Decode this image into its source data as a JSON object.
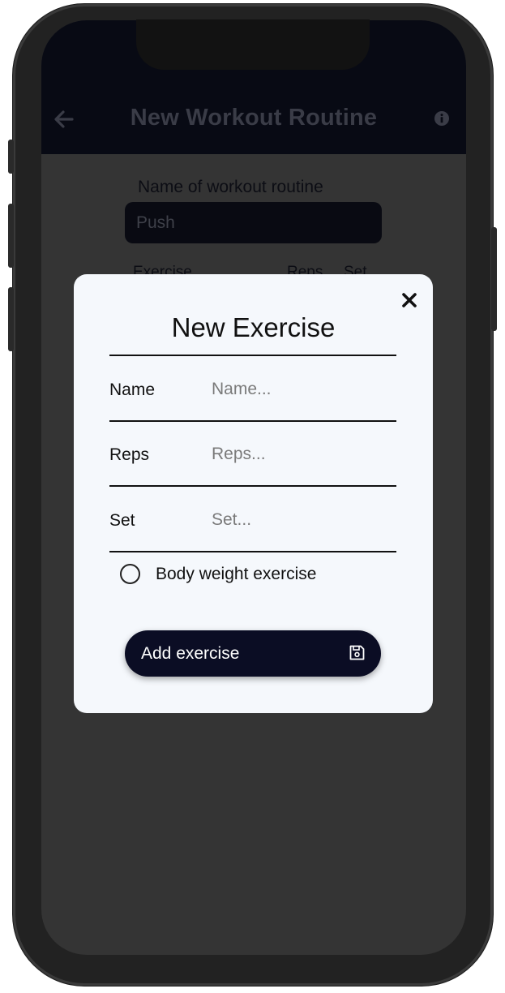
{
  "header": {
    "title": "New Workout Routine",
    "back_icon": "arrow-left-icon",
    "info_icon": "info-circle-icon"
  },
  "form": {
    "name_label": "Name of workout routine",
    "name_value": "Push",
    "columns": [
      "Exercise",
      "Reps",
      "Set"
    ]
  },
  "modal": {
    "title": "New Exercise",
    "close_icon": "close-icon",
    "fields": [
      {
        "label": "Name",
        "placeholder": "Name..."
      },
      {
        "label": "Reps",
        "placeholder": "Reps..."
      },
      {
        "label": "Set",
        "placeholder": "Set..."
      }
    ],
    "body_weight_label": "Body weight exercise",
    "body_weight_checked": false,
    "add_button_label": "Add exercise",
    "save_icon": "save-icon"
  },
  "colors": {
    "overlay_background": "#343434",
    "header_background": "#080a14",
    "modal_background": "#f5f8fc",
    "button_background": "#0b0d24"
  }
}
